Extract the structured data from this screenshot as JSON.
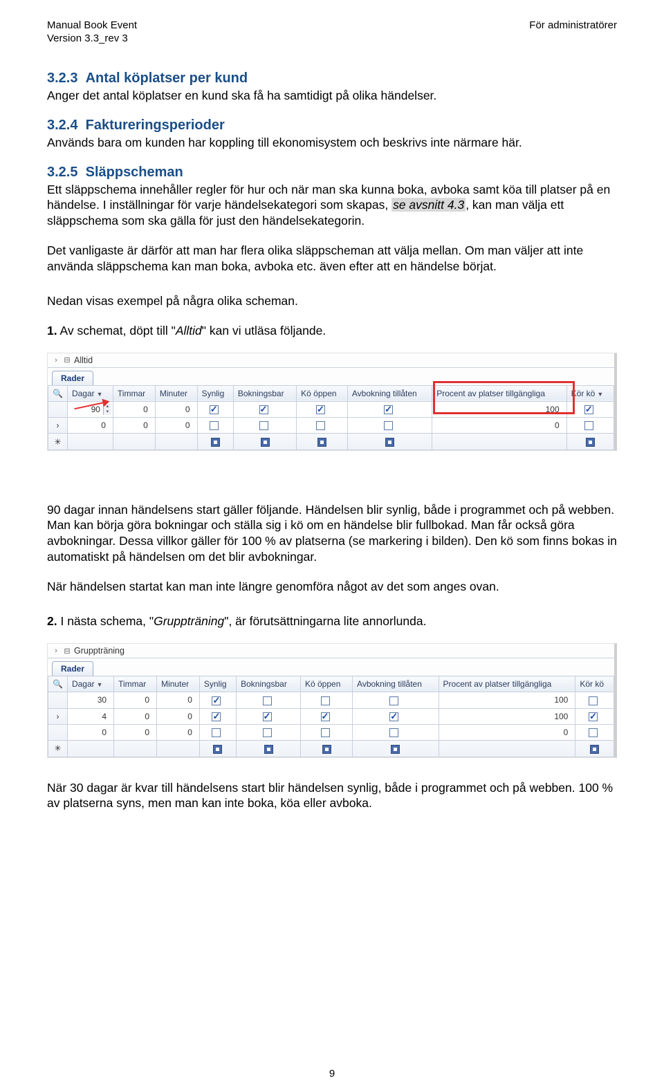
{
  "header": {
    "left": "Manual Book Event",
    "right": "För administratörer",
    "version": "Version 3.3_rev 3"
  },
  "sections": {
    "s1": {
      "num": "3.2.3",
      "title": "Antal köplatser per kund"
    },
    "s2": {
      "num": "3.2.4",
      "title": "Faktureringsperioder"
    },
    "s3": {
      "num": "3.2.5",
      "title": "Släppscheman"
    }
  },
  "body": {
    "p1": "Anger det antal köplatser en kund ska få ha samtidigt på olika händelser.",
    "p2": "Används bara om kunden har koppling till ekonomisystem och beskrivs inte närmare här.",
    "p3a": "Ett släppschema innehåller regler för hur och när man ska kunna boka, avboka samt köa till platser på en händelse. I inställningar för varje händelsekategori som skapas, ",
    "p3ref": "se avsnitt 4.3",
    "p3b": ", kan man välja ett släppschema som ska gälla för just den händelsekategorin.",
    "p4": "Det vanligaste är därför att man har flera olika släppscheman att välja mellan. Om man väljer att inte använda släppschema kan man boka, avboka etc. även efter att en händelse börjat.",
    "p5": "Nedan visas exempel på några olika scheman.",
    "p6a": "1.",
    "p6b": " Av schemat, döpt till \"",
    "p6i": "Alltid",
    "p6c": "\" kan vi utläsa följande.",
    "p7": "90 dagar innan händelsens start gäller följande. Händelsen blir synlig, både i programmet och på webben. Man kan börja göra bokningar och ställa sig i kö om en händelse blir fullbokad. Man får också göra avbokningar. Dessa villkor gäller för 100 % av platserna (se markering i bilden). Den kö som finns bokas in automatiskt på händelsen om det blir avbokningar.",
    "p8": "När händelsen startat kan man inte längre genomföra något av det som anges ovan.",
    "p9a": "2.",
    "p9b": " I nästa schema, \"",
    "p9i": "Gruppträning",
    "p9c": "\", är förutsättningarna lite annorlunda.",
    "p10": "När 30 dagar är kvar till händelsens start blir händelsen synlig, både i programmet och på webben. 100 % av platserna syns, men man kan inte boka, köa eller avboka."
  },
  "shot1": {
    "tree": "Alltid",
    "tab": "Rader",
    "headers": [
      "Dagar",
      "Timmar",
      "Minuter",
      "Synlig",
      "Bokningsbar",
      "Kö öppen",
      "Avbokning tillåten",
      "Procent av platser tillgängliga",
      "Kör kö"
    ],
    "row1": {
      "dagar": "90",
      "timmar": "0",
      "minuter": "0",
      "synlig": true,
      "bokbar": true,
      "ko": true,
      "avbok": true,
      "procent": "100",
      "korko": true
    },
    "row2": {
      "dagar": "0",
      "timmar": "0",
      "minuter": "0",
      "synlig": false,
      "bokbar": false,
      "ko": false,
      "avbok": false,
      "procent": "0",
      "korko": false
    }
  },
  "shot2": {
    "tree": "Gruppträning",
    "tab": "Rader",
    "headers": [
      "Dagar",
      "Timmar",
      "Minuter",
      "Synlig",
      "Bokningsbar",
      "Kö öppen",
      "Avbokning tillåten",
      "Procent av platser tillgängliga",
      "Kör kö"
    ],
    "rows": [
      {
        "dagar": "30",
        "timmar": "0",
        "minuter": "0",
        "synlig": true,
        "bokbar": false,
        "ko": false,
        "avbok": false,
        "procent": "100",
        "korko": false
      },
      {
        "dagar": "4",
        "timmar": "0",
        "minuter": "0",
        "synlig": true,
        "bokbar": true,
        "ko": true,
        "avbok": true,
        "procent": "100",
        "korko": true
      },
      {
        "dagar": "0",
        "timmar": "0",
        "minuter": "0",
        "synlig": false,
        "bokbar": false,
        "ko": false,
        "avbok": false,
        "procent": "0",
        "korko": false
      }
    ]
  },
  "pagenum": "9"
}
